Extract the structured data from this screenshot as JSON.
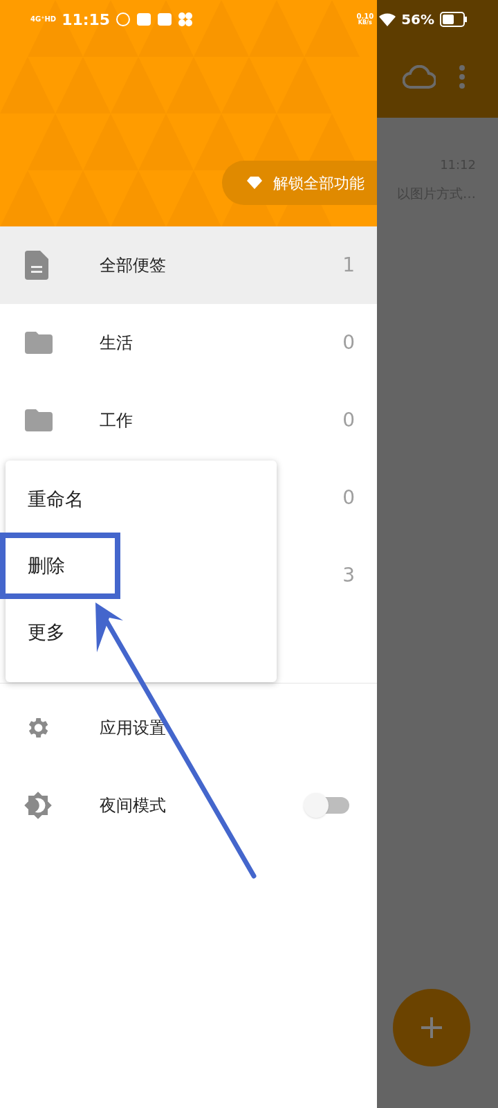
{
  "status_bar": {
    "network": "4G⁺HD",
    "time": "11:15",
    "speed": "0.10",
    "speed_unit": "KB/s",
    "battery": "56%"
  },
  "drawer": {
    "unlock_button": "解锁全部功能",
    "folders": [
      {
        "kind": "all",
        "label": "全部便签",
        "count": "1",
        "selected": true
      },
      {
        "kind": "folder",
        "label": "生活",
        "count": "0",
        "selected": false
      },
      {
        "kind": "folder",
        "label": "工作",
        "count": "0",
        "selected": false
      },
      {
        "kind": "hidden",
        "count": "0",
        "selected": false
      },
      {
        "kind": "hidden",
        "count": "3",
        "selected": false
      }
    ],
    "settings": [
      {
        "kind": "gear",
        "label": "应用设置"
      },
      {
        "kind": "night",
        "label": "夜间模式",
        "on": false
      }
    ]
  },
  "context_menu": [
    {
      "label": "重命名",
      "highlighted": false
    },
    {
      "label": "删除",
      "highlighted": true
    },
    {
      "label": "更多",
      "highlighted": false
    }
  ],
  "background_note": {
    "time": "11:12",
    "preview": "以图片方式…"
  }
}
